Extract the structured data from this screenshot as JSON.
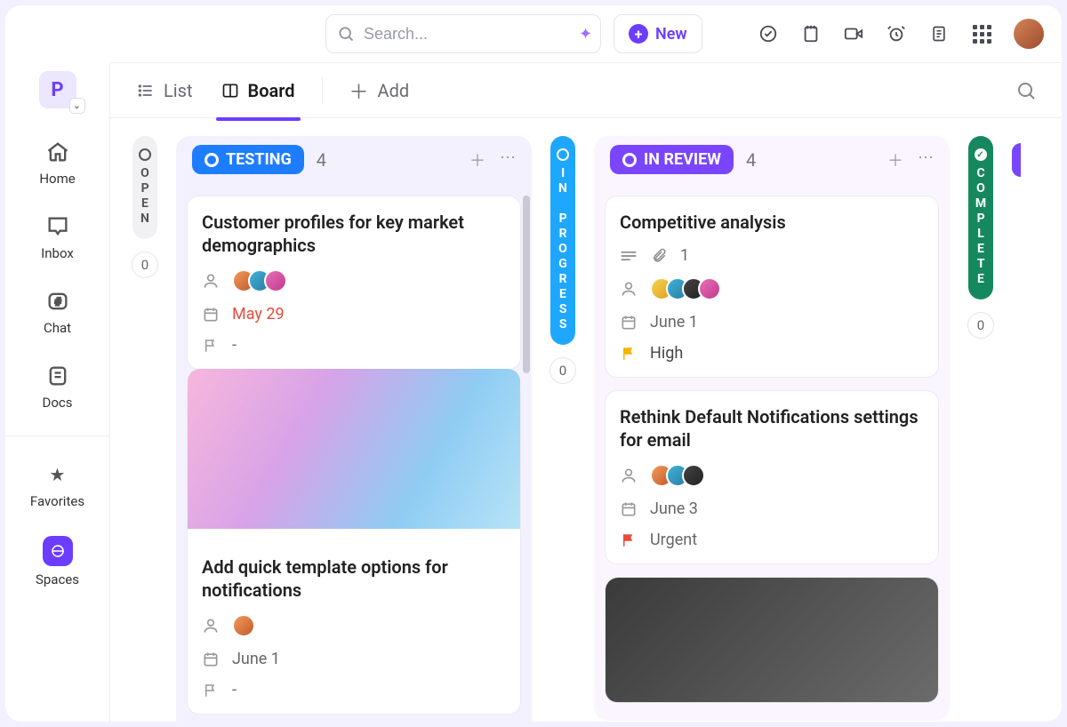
{
  "topbar": {
    "search_placeholder": "Search...",
    "new_label": "New"
  },
  "sidebar": {
    "workspace_letter": "P",
    "home": "Home",
    "inbox": "Inbox",
    "chat": "Chat",
    "docs": "Docs",
    "favorites": "Favorites",
    "spaces": "Spaces"
  },
  "tabs": {
    "list": "List",
    "board": "Board",
    "add": "Add"
  },
  "columns": {
    "open": {
      "label": "OPEN",
      "count": "0"
    },
    "testing": {
      "label": "TESTING",
      "count": "4"
    },
    "in_progress": {
      "label": "IN PROGRESS",
      "count": "0"
    },
    "in_review": {
      "label": "IN REVIEW",
      "count": "4"
    },
    "complete": {
      "label": "COMPLETE",
      "count": "0"
    }
  },
  "cards": {
    "t1": {
      "title": "Customer profiles for key market demographics",
      "date": "May 29",
      "priority_dash": "-"
    },
    "t2": {
      "title": "Add quick template options for notifications",
      "date": "June 1",
      "priority_dash": "-"
    },
    "r1": {
      "title": "Competitive analysis",
      "attach": "1",
      "date": "June 1",
      "priority": "High"
    },
    "r2": {
      "title": "Rethink Default Notifications settings for email",
      "date": "June 3",
      "priority": "Urgent"
    }
  }
}
